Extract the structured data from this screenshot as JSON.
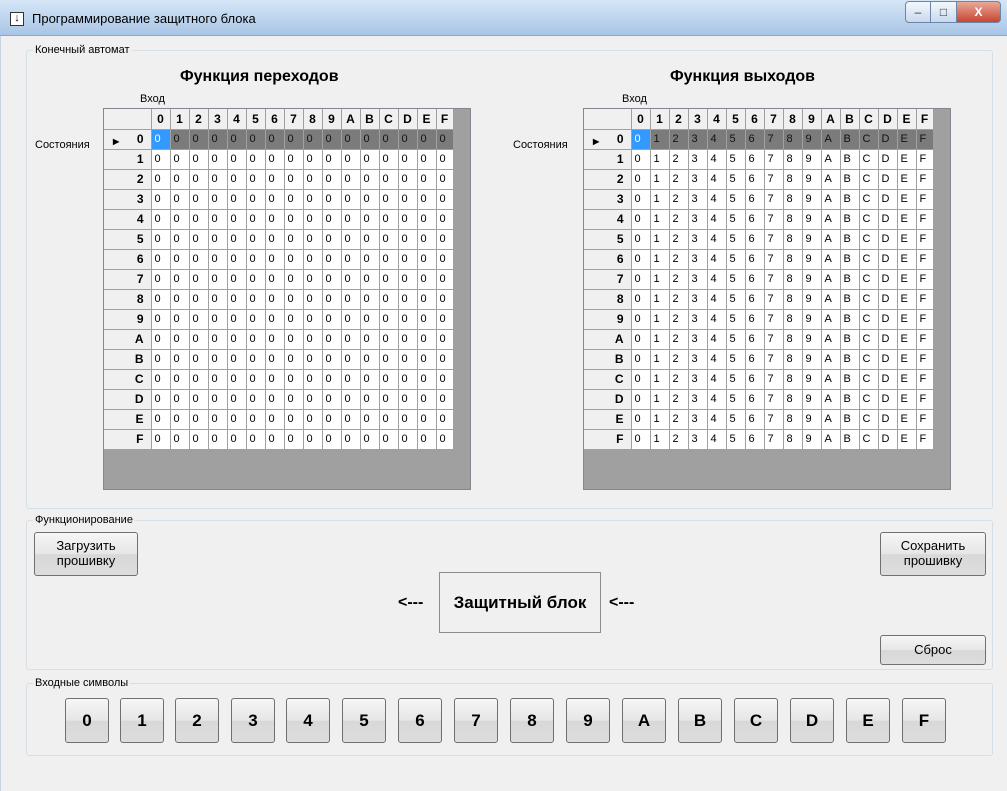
{
  "window": {
    "title": "Программирование защитного блока",
    "icon": "download-icon",
    "min_label": "–",
    "max_label": "□",
    "close_label": "X"
  },
  "fsm_group": {
    "label": "Конечный автомат",
    "transitions": {
      "title": "Функция переходов",
      "input_label": "Вход",
      "states_label": "Состояния"
    },
    "outputs": {
      "title": "Функция выходов",
      "input_label": "Вход",
      "states_label": "Состояния"
    },
    "columns": [
      "0",
      "1",
      "2",
      "3",
      "4",
      "5",
      "6",
      "7",
      "8",
      "9",
      "A",
      "B",
      "C",
      "D",
      "E",
      "F"
    ],
    "rows": [
      "0",
      "1",
      "2",
      "3",
      "4",
      "5",
      "6",
      "7",
      "8",
      "9",
      "A",
      "B",
      "C",
      "D",
      "E",
      "F"
    ],
    "transition_values": [
      [
        "0",
        "0",
        "0",
        "0",
        "0",
        "0",
        "0",
        "0",
        "0",
        "0",
        "0",
        "0",
        "0",
        "0",
        "0",
        "0"
      ],
      [
        "0",
        "0",
        "0",
        "0",
        "0",
        "0",
        "0",
        "0",
        "0",
        "0",
        "0",
        "0",
        "0",
        "0",
        "0",
        "0"
      ],
      [
        "0",
        "0",
        "0",
        "0",
        "0",
        "0",
        "0",
        "0",
        "0",
        "0",
        "0",
        "0",
        "0",
        "0",
        "0",
        "0"
      ],
      [
        "0",
        "0",
        "0",
        "0",
        "0",
        "0",
        "0",
        "0",
        "0",
        "0",
        "0",
        "0",
        "0",
        "0",
        "0",
        "0"
      ],
      [
        "0",
        "0",
        "0",
        "0",
        "0",
        "0",
        "0",
        "0",
        "0",
        "0",
        "0",
        "0",
        "0",
        "0",
        "0",
        "0"
      ],
      [
        "0",
        "0",
        "0",
        "0",
        "0",
        "0",
        "0",
        "0",
        "0",
        "0",
        "0",
        "0",
        "0",
        "0",
        "0",
        "0"
      ],
      [
        "0",
        "0",
        "0",
        "0",
        "0",
        "0",
        "0",
        "0",
        "0",
        "0",
        "0",
        "0",
        "0",
        "0",
        "0",
        "0"
      ],
      [
        "0",
        "0",
        "0",
        "0",
        "0",
        "0",
        "0",
        "0",
        "0",
        "0",
        "0",
        "0",
        "0",
        "0",
        "0",
        "0"
      ],
      [
        "0",
        "0",
        "0",
        "0",
        "0",
        "0",
        "0",
        "0",
        "0",
        "0",
        "0",
        "0",
        "0",
        "0",
        "0",
        "0"
      ],
      [
        "0",
        "0",
        "0",
        "0",
        "0",
        "0",
        "0",
        "0",
        "0",
        "0",
        "0",
        "0",
        "0",
        "0",
        "0",
        "0"
      ],
      [
        "0",
        "0",
        "0",
        "0",
        "0",
        "0",
        "0",
        "0",
        "0",
        "0",
        "0",
        "0",
        "0",
        "0",
        "0",
        "0"
      ],
      [
        "0",
        "0",
        "0",
        "0",
        "0",
        "0",
        "0",
        "0",
        "0",
        "0",
        "0",
        "0",
        "0",
        "0",
        "0",
        "0"
      ],
      [
        "0",
        "0",
        "0",
        "0",
        "0",
        "0",
        "0",
        "0",
        "0",
        "0",
        "0",
        "0",
        "0",
        "0",
        "0",
        "0"
      ],
      [
        "0",
        "0",
        "0",
        "0",
        "0",
        "0",
        "0",
        "0",
        "0",
        "0",
        "0",
        "0",
        "0",
        "0",
        "0",
        "0"
      ],
      [
        "0",
        "0",
        "0",
        "0",
        "0",
        "0",
        "0",
        "0",
        "0",
        "0",
        "0",
        "0",
        "0",
        "0",
        "0",
        "0"
      ],
      [
        "0",
        "0",
        "0",
        "0",
        "0",
        "0",
        "0",
        "0",
        "0",
        "0",
        "0",
        "0",
        "0",
        "0",
        "0",
        "0"
      ]
    ],
    "output_values": [
      [
        "0",
        "1",
        "2",
        "3",
        "4",
        "5",
        "6",
        "7",
        "8",
        "9",
        "A",
        "B",
        "C",
        "D",
        "E",
        "F"
      ],
      [
        "0",
        "1",
        "2",
        "3",
        "4",
        "5",
        "6",
        "7",
        "8",
        "9",
        "A",
        "B",
        "C",
        "D",
        "E",
        "F"
      ],
      [
        "0",
        "1",
        "2",
        "3",
        "4",
        "5",
        "6",
        "7",
        "8",
        "9",
        "A",
        "B",
        "C",
        "D",
        "E",
        "F"
      ],
      [
        "0",
        "1",
        "2",
        "3",
        "4",
        "5",
        "6",
        "7",
        "8",
        "9",
        "A",
        "B",
        "C",
        "D",
        "E",
        "F"
      ],
      [
        "0",
        "1",
        "2",
        "3",
        "4",
        "5",
        "6",
        "7",
        "8",
        "9",
        "A",
        "B",
        "C",
        "D",
        "E",
        "F"
      ],
      [
        "0",
        "1",
        "2",
        "3",
        "4",
        "5",
        "6",
        "7",
        "8",
        "9",
        "A",
        "B",
        "C",
        "D",
        "E",
        "F"
      ],
      [
        "0",
        "1",
        "2",
        "3",
        "4",
        "5",
        "6",
        "7",
        "8",
        "9",
        "A",
        "B",
        "C",
        "D",
        "E",
        "F"
      ],
      [
        "0",
        "1",
        "2",
        "3",
        "4",
        "5",
        "6",
        "7",
        "8",
        "9",
        "A",
        "B",
        "C",
        "D",
        "E",
        "F"
      ],
      [
        "0",
        "1",
        "2",
        "3",
        "4",
        "5",
        "6",
        "7",
        "8",
        "9",
        "A",
        "B",
        "C",
        "D",
        "E",
        "F"
      ],
      [
        "0",
        "1",
        "2",
        "3",
        "4",
        "5",
        "6",
        "7",
        "8",
        "9",
        "A",
        "B",
        "C",
        "D",
        "E",
        "F"
      ],
      [
        "0",
        "1",
        "2",
        "3",
        "4",
        "5",
        "6",
        "7",
        "8",
        "9",
        "A",
        "B",
        "C",
        "D",
        "E",
        "F"
      ],
      [
        "0",
        "1",
        "2",
        "3",
        "4",
        "5",
        "6",
        "7",
        "8",
        "9",
        "A",
        "B",
        "C",
        "D",
        "E",
        "F"
      ],
      [
        "0",
        "1",
        "2",
        "3",
        "4",
        "5",
        "6",
        "7",
        "8",
        "9",
        "A",
        "B",
        "C",
        "D",
        "E",
        "F"
      ],
      [
        "0",
        "1",
        "2",
        "3",
        "4",
        "5",
        "6",
        "7",
        "8",
        "9",
        "A",
        "B",
        "C",
        "D",
        "E",
        "F"
      ],
      [
        "0",
        "1",
        "2",
        "3",
        "4",
        "5",
        "6",
        "7",
        "8",
        "9",
        "A",
        "B",
        "C",
        "D",
        "E",
        "F"
      ],
      [
        "0",
        "1",
        "2",
        "3",
        "4",
        "5",
        "6",
        "7",
        "8",
        "9",
        "A",
        "B",
        "C",
        "D",
        "E",
        "F"
      ]
    ],
    "selected_row": "0",
    "row_pointer_icon": "row-pointer-icon"
  },
  "operation_group": {
    "label": "Функционирование",
    "load_line1": "Загрузить",
    "load_line2": "прошивку",
    "save_line1": "Сохранить",
    "save_line2": "прошивку",
    "reset_label": "Сброс",
    "left_arrow": "<---",
    "right_arrow": "<---",
    "block_label": "Защитный блок"
  },
  "input_group": {
    "label": "Входные символы",
    "symbols": [
      "0",
      "1",
      "2",
      "3",
      "4",
      "5",
      "6",
      "7",
      "8",
      "9",
      "A",
      "B",
      "C",
      "D",
      "E",
      "F"
    ]
  },
  "colors": {
    "selected_row": "#7b7b7b",
    "current_cell": "#3399ff",
    "title_bar": "#bcd4ee",
    "close_button": "#c8462f"
  }
}
